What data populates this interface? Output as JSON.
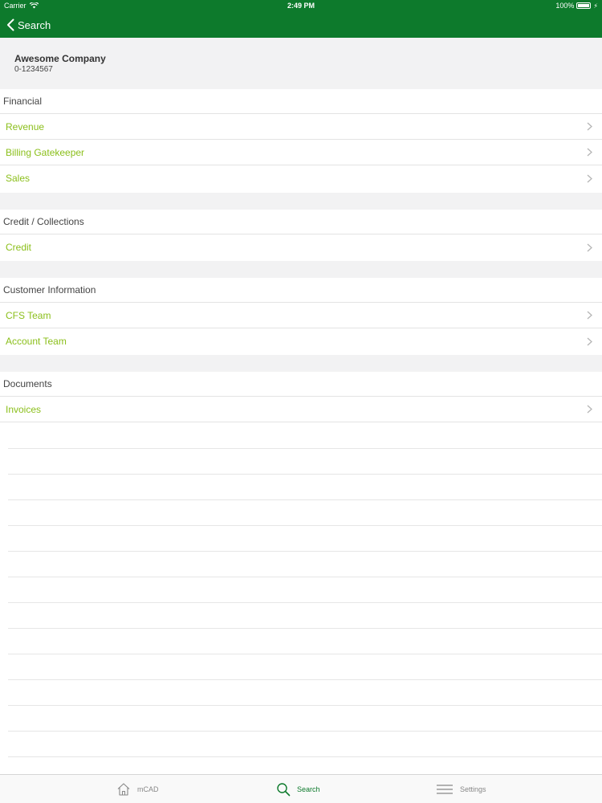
{
  "status_bar": {
    "carrier": "Carrier",
    "time": "2:49 PM",
    "battery": "100%"
  },
  "nav": {
    "back_label": "Search"
  },
  "company": {
    "name": "Awesome Company",
    "number": "0-1234567"
  },
  "sections": [
    {
      "title": "Financial",
      "items": [
        "Revenue",
        "Billing Gatekeeper",
        "Sales"
      ]
    },
    {
      "title": "Credit / Collections",
      "items": [
        "Credit"
      ]
    },
    {
      "title": "Customer Information",
      "items": [
        "CFS Team",
        "Account Team"
      ]
    },
    {
      "title": "Documents",
      "items": [
        "Invoices"
      ]
    }
  ],
  "tabs": [
    {
      "label": "mCAD",
      "icon": "home-icon",
      "active": false
    },
    {
      "label": "Search",
      "icon": "search-icon",
      "active": true
    },
    {
      "label": "Settings",
      "icon": "menu-icon",
      "active": false
    }
  ],
  "colors": {
    "nav_bg": "#0d7a2c",
    "link": "#8bbf1b",
    "group_bg": "#f2f2f3"
  }
}
